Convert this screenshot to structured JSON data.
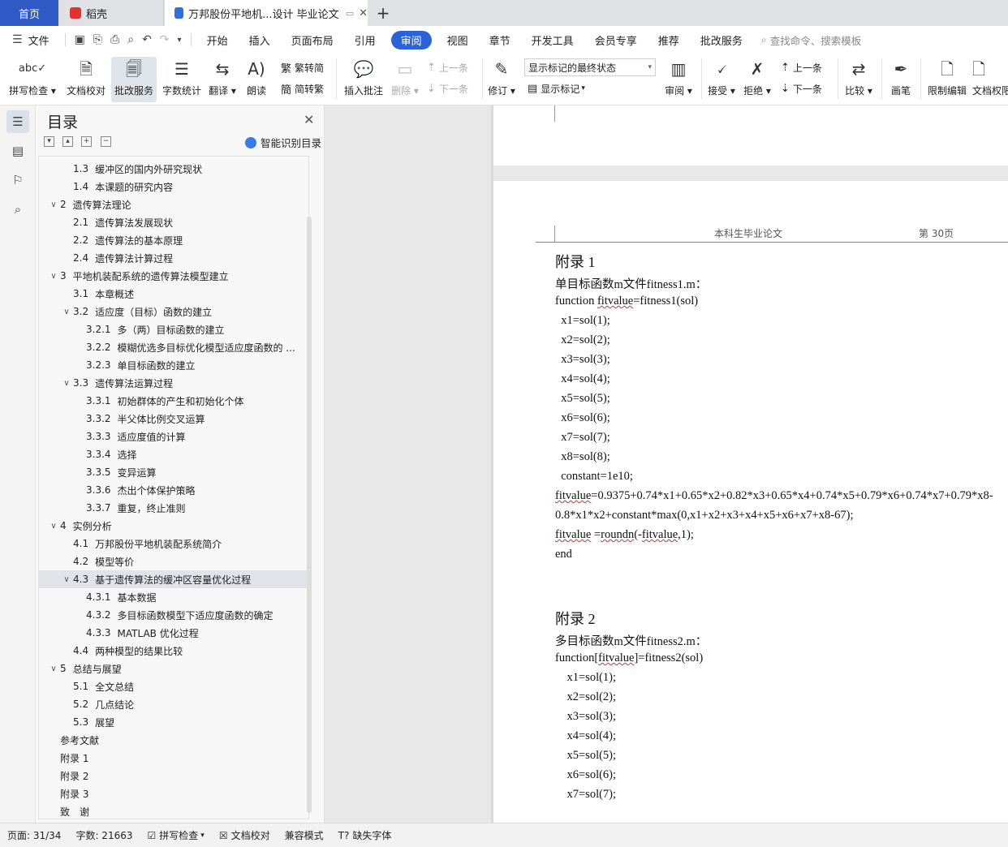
{
  "tabs": {
    "home": "首页",
    "daoke": "稻壳",
    "doc": "万邦股份平地机...设计 毕业论文",
    "accent": "#2f5ac6"
  },
  "menu": {
    "file": "文件",
    "items": [
      "开始",
      "插入",
      "页面布局",
      "引用",
      "审阅",
      "视图",
      "章节",
      "开发工具",
      "会员专享",
      "推荐",
      "批改服务"
    ],
    "active": "审阅",
    "search": "查找命令、搜索模板"
  },
  "ribbon": {
    "spell": "拼写检查",
    "proof": "文档校对",
    "correct": "批改服务",
    "wordcount": "字数统计",
    "translate": "翻译",
    "read": "朗读",
    "trad": "繁转简",
    "simp": "简转繁",
    "insert_comment": "插入批注",
    "delete": "删除",
    "prev1": "上一条",
    "next1": "下一条",
    "revise": "修订",
    "markup_state": "显示标记的最终状态",
    "show_markup": "显示标记",
    "review": "审阅",
    "accept": "接受",
    "reject": "拒绝",
    "prev2": "上一条",
    "next2": "下一条",
    "compare": "比较",
    "pen": "画笔",
    "restrict": "限制编辑",
    "docperm": "文档权限"
  },
  "toc": {
    "title": "目录",
    "smart": "智能识别目录",
    "items": [
      {
        "num": "1.3",
        "text": "缓冲区的国内外研究现状",
        "level": 2
      },
      {
        "num": "1.4",
        "text": "本课题的研究内容",
        "level": 2
      },
      {
        "num": "2",
        "text": "遗传算法理论",
        "level": 1,
        "chev": true
      },
      {
        "num": "2.1",
        "text": "遗传算法发展现状",
        "level": 2
      },
      {
        "num": "2.2",
        "text": "遗传算法的基本原理",
        "level": 2
      },
      {
        "num": "2.4",
        "text": "遗传算法计算过程",
        "level": 2
      },
      {
        "num": "3",
        "text": "平地机装配系统的遗传算法模型建立",
        "level": 1,
        "chev": true
      },
      {
        "num": "3.1",
        "text": "本章概述",
        "level": 2
      },
      {
        "num": "3.2",
        "text": "适应度（目标）函数的建立",
        "level": 2,
        "chev": true
      },
      {
        "num": "3.2.1",
        "text": "多（两）目标函数的建立",
        "level": 3
      },
      {
        "num": "3.2.2",
        "text": "模糊优选多目标优化模型适应度函数的 ...",
        "level": 3
      },
      {
        "num": "3.2.3",
        "text": "单目标函数的建立",
        "level": 3
      },
      {
        "num": "3.3",
        "text": "遗传算法运算过程",
        "level": 2,
        "chev": true
      },
      {
        "num": "3.3.1",
        "text": "初始群体的产生和初始化个体",
        "level": 3
      },
      {
        "num": "3.3.2",
        "text": "半父体比例交叉运算",
        "level": 3
      },
      {
        "num": "3.3.3",
        "text": "适应度值的计算",
        "level": 3
      },
      {
        "num": "3.3.4",
        "text": "选择",
        "level": 3
      },
      {
        "num": "3.3.5",
        "text": "变异运算",
        "level": 3
      },
      {
        "num": "3.3.6",
        "text": "杰出个体保护策略",
        "level": 3
      },
      {
        "num": "3.3.7",
        "text": "重复，终止准则",
        "level": 3
      },
      {
        "num": "4",
        "text": "实例分析",
        "level": 1,
        "chev": true
      },
      {
        "num": "4.1",
        "text": "万邦股份平地机装配系统简介",
        "level": 2
      },
      {
        "num": "4.2",
        "text": "模型等价",
        "level": 2
      },
      {
        "num": "4.3",
        "text": "基于遗传算法的缓冲区容量优化过程",
        "level": 2,
        "chev": true,
        "selected": true
      },
      {
        "num": "4.3.1",
        "text": "基本数据",
        "level": 3
      },
      {
        "num": "4.3.2",
        "text": "多目标函数模型下适应度函数的确定",
        "level": 3
      },
      {
        "num": "4.3.3",
        "text": "MATLAB 优化过程",
        "level": 3
      },
      {
        "num": "4.4",
        "text": "两种模型的结果比较",
        "level": 2
      },
      {
        "num": "5",
        "text": "总结与展望",
        "level": 1,
        "chev": true
      },
      {
        "num": "5.1",
        "text": "全文总结",
        "level": 2
      },
      {
        "num": "5.2",
        "text": "几点结论",
        "level": 2
      },
      {
        "num": "5.3",
        "text": "展望",
        "level": 2
      },
      {
        "num": "",
        "text": "参考文献",
        "level": 1
      },
      {
        "num": "",
        "text": "附录 1",
        "level": 1
      },
      {
        "num": "",
        "text": "附录 2",
        "level": 1
      },
      {
        "num": "",
        "text": "附录 3",
        "level": 1
      },
      {
        "num": "",
        "text": "致　谢",
        "level": 1
      }
    ]
  },
  "document": {
    "header_title": "本科生毕业论文",
    "header_page": "第 30页",
    "lines": [
      {
        "text": "附录 1",
        "head": true
      },
      {
        "text": "单目标函数m文件fitness1.m："
      },
      {
        "text": "function fitvalue=fitness1(sol)"
      },
      {
        "text": "  x1=sol(1);"
      },
      {
        "text": "  x2=sol(2);"
      },
      {
        "text": "  x3=sol(3);"
      },
      {
        "text": "  x4=sol(4);"
      },
      {
        "text": "  x5=sol(5);"
      },
      {
        "text": "  x6=sol(6);"
      },
      {
        "text": "  x7=sol(7);"
      },
      {
        "text": "  x8=sol(8);"
      },
      {
        "text": "  constant=1e10;"
      },
      {
        "text": "fitvalue=0.9375+0.74*x1+0.65*x2+0.82*x3+0.65*x4+0.74*x5+0.79*x6+0.74*x7+0.79*x8-"
      },
      {
        "text": "0.8*x1*x2+constant*max(0,x1+x2+x3+x4+x5+x6+x7+x8-67);"
      },
      {
        "text": "fitvalue =roundn(-fitvalue,1);"
      },
      {
        "text": "end"
      },
      {
        "text": "附录 2",
        "head": true
      },
      {
        "text": "多目标函数m文件fitness2.m："
      },
      {
        "text": "function[fitvalue]=fitness2(sol)"
      },
      {
        "text": "    x1=sol(1);"
      },
      {
        "text": "    x2=sol(2);"
      },
      {
        "text": "    x3=sol(3);"
      },
      {
        "text": "    x4=sol(4);"
      },
      {
        "text": "    x5=sol(5);"
      },
      {
        "text": "    x6=sol(6);"
      },
      {
        "text": "    x7=sol(7);"
      }
    ]
  },
  "status": {
    "page": "页面: 31/34",
    "words": "字数: 21663",
    "spell": "拼写检查",
    "proof": "文档校对",
    "compat": "兼容模式",
    "missing_font": "缺失字体"
  }
}
